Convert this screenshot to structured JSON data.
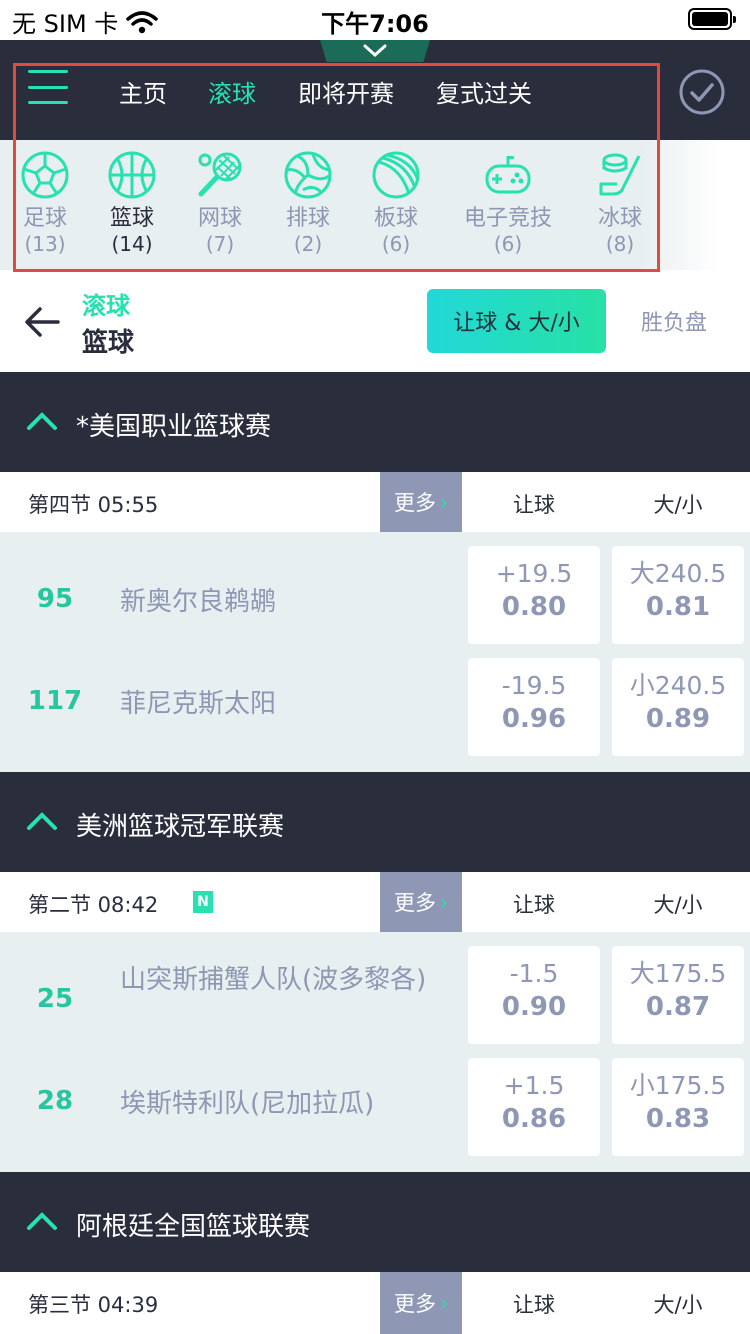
{
  "status_bar": {
    "carrier": "无 SIM 卡",
    "time": "下午7:06"
  },
  "nav": {
    "tabs": [
      {
        "label": "主页",
        "active": false
      },
      {
        "label": "滚球",
        "active": true
      },
      {
        "label": "即将开赛",
        "active": false
      },
      {
        "label": "复式过关",
        "active": false
      }
    ]
  },
  "sports": [
    {
      "name": "足球",
      "count": "(13)",
      "icon": "soccer-ball-icon"
    },
    {
      "name": "篮球",
      "count": "(14)",
      "icon": "basketball-icon",
      "active": true
    },
    {
      "name": "网球",
      "count": "(7)",
      "icon": "tennis-racket-icon"
    },
    {
      "name": "排球",
      "count": "(2)",
      "icon": "volleyball-icon"
    },
    {
      "name": "板球",
      "count": "(6)",
      "icon": "cricket-ball-icon"
    },
    {
      "name": "电子竞技",
      "count": "(6)",
      "icon": "gamepad-icon"
    },
    {
      "name": "冰球",
      "count": "(8)",
      "icon": "hockey-icon"
    }
  ],
  "header": {
    "subtitle": "滚球",
    "title": "篮球",
    "segment_active": "让球 & 大/小",
    "segment_inactive": "胜负盘"
  },
  "columns": {
    "handicap": "让球",
    "over_under": "大/小",
    "more": "更多"
  },
  "leagues": [
    {
      "name": "*美国职业篮球赛",
      "period": "第四节  05:55",
      "has_new_badge": false,
      "teams": [
        {
          "score": "95",
          "name": "新奥尔良鹈鹕",
          "handicap_line": "+19.5",
          "handicap_odds": "0.80",
          "ou_line": "大240.5",
          "ou_odds": "0.81"
        },
        {
          "score": "117",
          "name": "菲尼克斯太阳",
          "handicap_line": "-19.5",
          "handicap_odds": "0.96",
          "ou_line": "小240.5",
          "ou_odds": "0.89"
        }
      ]
    },
    {
      "name": "美洲篮球冠军联赛",
      "period": "第二节  08:42",
      "has_new_badge": true,
      "badge": "N",
      "teams": [
        {
          "score": "25",
          "name": "山突斯捕蟹人队(波多黎各)",
          "handicap_line": "-1.5",
          "handicap_odds": "0.90",
          "ou_line": "大175.5",
          "ou_odds": "0.87"
        },
        {
          "score": "28",
          "name": "埃斯特利队(尼加拉瓜)",
          "handicap_line": "+1.5",
          "handicap_odds": "0.86",
          "ou_line": "小175.5",
          "ou_odds": "0.83"
        }
      ]
    },
    {
      "name": "阿根廷全国篮球联赛",
      "period": "第三节  04:39",
      "has_new_badge": false,
      "teams": []
    }
  ],
  "colors": {
    "accent": "#27e1b1",
    "dark": "#2a2d3c",
    "muted": "#8e97b4",
    "highlight": "#e04a3f"
  }
}
